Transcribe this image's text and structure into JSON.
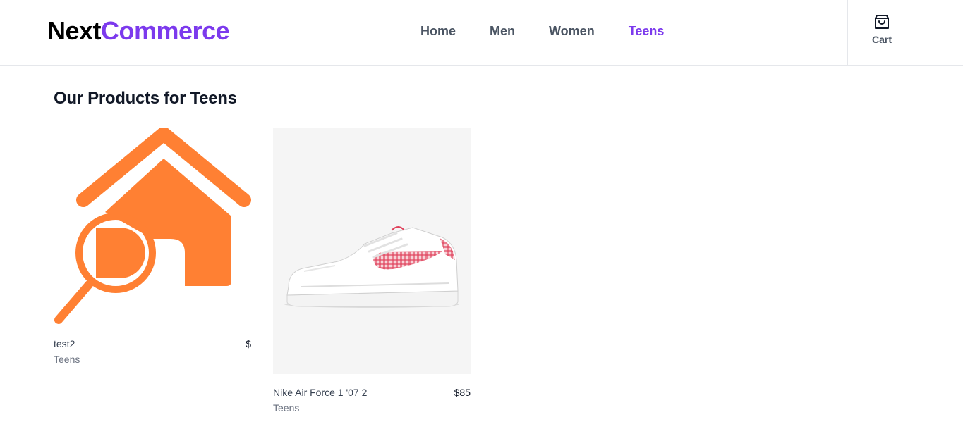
{
  "header": {
    "logo_part1": "Next",
    "logo_part2": "Commerce",
    "nav": [
      {
        "label": "Home"
      },
      {
        "label": "Men"
      },
      {
        "label": "Women"
      },
      {
        "label": "Teens",
        "active": true
      }
    ],
    "cart_label": "Cart",
    "icons": {
      "cart": "shopping-bag-icon"
    }
  },
  "main": {
    "title": "Our Products for Teens",
    "products": [
      {
        "name": "test2",
        "price": "$",
        "category": "Teens",
        "image": "house-search-icon"
      },
      {
        "name": "Nike Air Force 1 '07 2",
        "price": "$85",
        "category": "Teens",
        "image": "sneaker-image"
      }
    ]
  },
  "colors": {
    "brand": "#7c3aed",
    "icon_orange": "#ff8033",
    "text_muted": "#6b7280"
  }
}
